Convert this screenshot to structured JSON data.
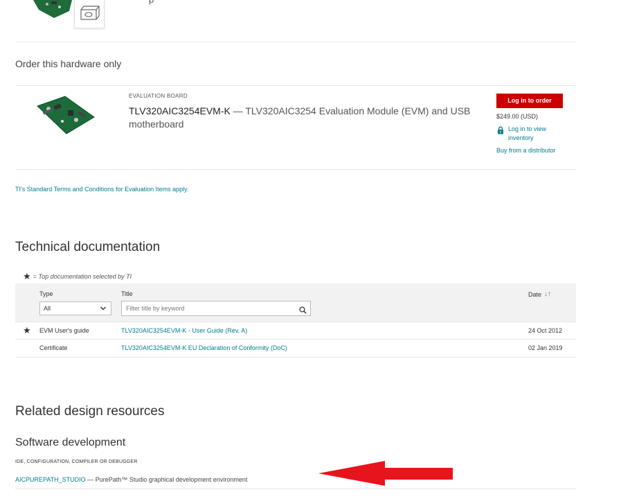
{
  "top_partial_text": "p",
  "order": {
    "heading": "Order this hardware only",
    "category": "EVALUATION BOARD",
    "part_number": "TLV320AIC3254EVM-K",
    "separator": " — ",
    "description": "TLV320AIC3254 Evaluation Module (EVM) and USB motherboard",
    "login_button": "Log in to order",
    "price": "$249.00 (USD)",
    "login_inventory": "Log in to view inventory",
    "buy_distributor": "Buy from a distributor"
  },
  "terms_link": "TI's Standard Terms and Conditions for Evaluation Items apply.",
  "tech_docs": {
    "heading": "Technical documentation",
    "legend": "= Top documentation selected by TI",
    "columns": {
      "type": "Type",
      "title": "Title",
      "date": "Date"
    },
    "type_filter_value": "All",
    "title_filter_placeholder": "Filter title by keyword",
    "rows": [
      {
        "top_doc": true,
        "type": "EVM User's guide",
        "title": "TLV320AIC3254EVM-K - User Guide (Rev. A)",
        "date": "24 Oct 2012"
      },
      {
        "top_doc": false,
        "type": "Certificate",
        "title": "TLV320AIC3254EVM-K EU Declaration of Conformity (DoC)",
        "date": "02 Jan 2019"
      }
    ]
  },
  "related": {
    "heading": "Related design resources",
    "software_heading": "Software development",
    "category": "IDE, CONFIGURATION, COMPILER OR DEBUGGER",
    "tool_name": "AICPUREPATH_STUDIO",
    "tool_separator": " — ",
    "tool_desc": "PurePath™ Studio graphical development environment"
  },
  "colors": {
    "accent_teal": "#007c8c",
    "order_red": "#cc0000",
    "annotation_arrow": "#e8141c"
  },
  "icons": [
    "box-link-icon",
    "lock-icon",
    "star-icon",
    "chevron-down-icon",
    "search-icon",
    "sort-icon",
    "red-arrow-annotation"
  ]
}
